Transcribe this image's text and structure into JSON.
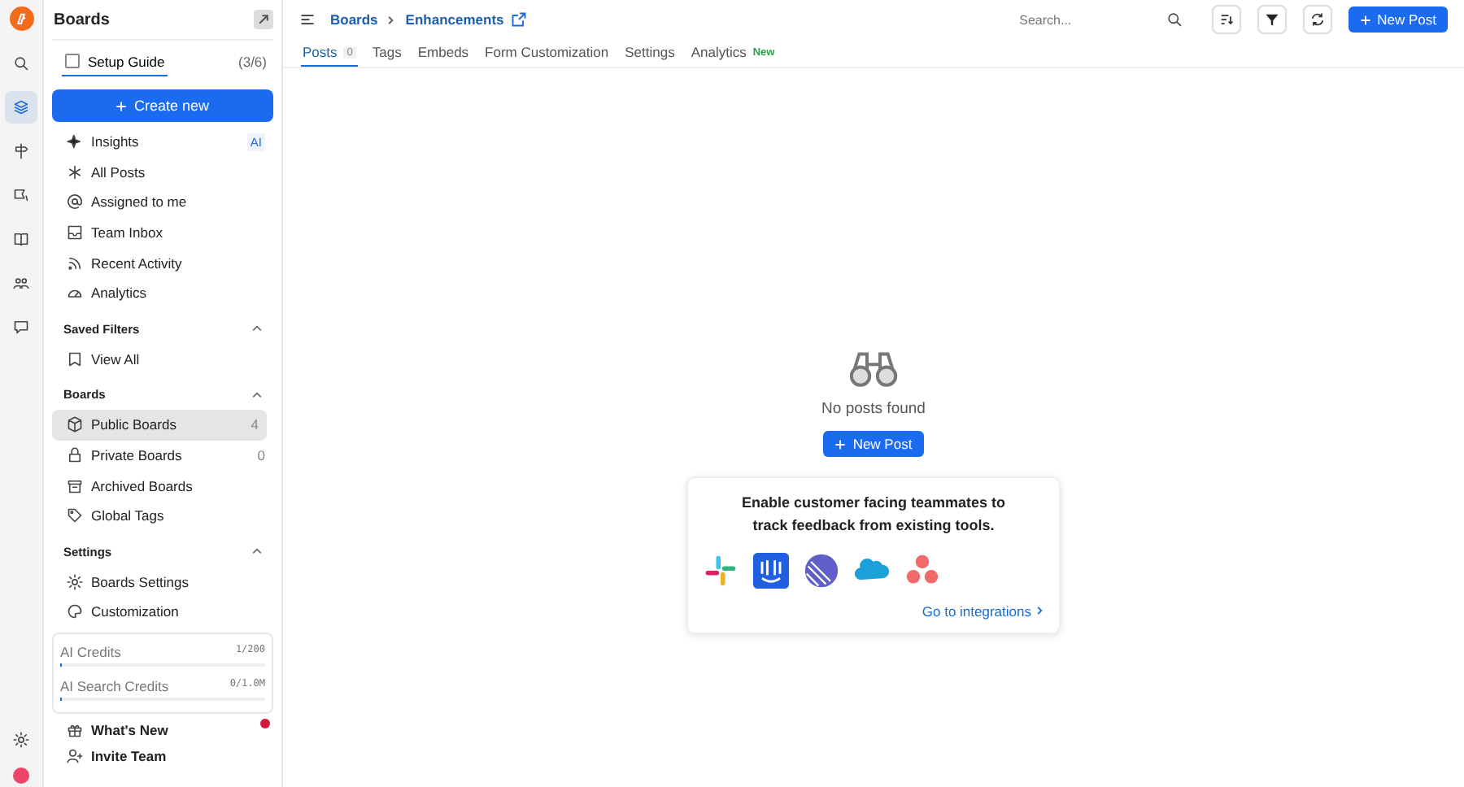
{
  "rail": [
    {
      "kind": "search",
      "selected": false
    },
    {
      "kind": "layers",
      "selected": true
    },
    {
      "kind": "signpost",
      "selected": false
    },
    {
      "kind": "flag",
      "selected": false
    },
    {
      "kind": "book",
      "selected": false
    },
    {
      "kind": "people",
      "selected": false
    },
    {
      "kind": "chat",
      "selected": false
    }
  ],
  "sidebar": {
    "title": "Boards",
    "setup_guide": {
      "label": "Setup Guide",
      "progress": "(3/6)",
      "checked": false
    },
    "create_button": "Create new",
    "nav": [
      {
        "kind": "sparkle",
        "label": "Insights",
        "badge": "AI"
      },
      {
        "kind": "star",
        "label": "All Posts"
      },
      {
        "kind": "at",
        "label": "Assigned to me"
      },
      {
        "kind": "inbox",
        "label": "Team Inbox"
      },
      {
        "kind": "rss",
        "label": "Recent Activity"
      },
      {
        "kind": "gauge",
        "label": "Analytics"
      }
    ],
    "sections": [
      {
        "title": "Saved Filters",
        "expanded": true,
        "items": [
          {
            "kind": "bookmark",
            "label": "View All",
            "selected": false
          }
        ]
      },
      {
        "title": "Boards",
        "expanded": true,
        "items": [
          {
            "kind": "cube",
            "label": "Public Boards",
            "count": "4",
            "selected": true
          },
          {
            "kind": "lock",
            "label": "Private Boards",
            "count": "0",
            "selected": false
          },
          {
            "kind": "archive",
            "label": "Archived Boards",
            "selected": false
          },
          {
            "kind": "tag",
            "label": "Global Tags",
            "selected": false
          }
        ]
      },
      {
        "title": "Settings",
        "expanded": true,
        "items": [
          {
            "kind": "gear",
            "label": "Boards Settings",
            "selected": false
          },
          {
            "kind": "palette",
            "label": "Customization",
            "selected": false
          }
        ]
      }
    ],
    "credits": [
      {
        "label": "AI Credits",
        "reading": "1/200",
        "level": 0.005
      },
      {
        "label": "AI Search Credits",
        "reading": "0/1.0M",
        "level": 0
      }
    ],
    "footer": [
      {
        "kind": "gift",
        "label": "What's New",
        "notification": true
      },
      {
        "kind": "person-add",
        "label": "Invite Team",
        "notification": false
      }
    ]
  },
  "header": {
    "breadcrumb": [
      "Boards",
      "Enhancements"
    ],
    "search": {
      "placeholder": "Search..."
    },
    "new_post": "New Post",
    "tabs": [
      {
        "label": "Posts",
        "count": "0",
        "selected": true
      },
      {
        "label": "Tags",
        "selected": false
      },
      {
        "label": "Embeds",
        "selected": false
      },
      {
        "label": "Form Customization",
        "selected": false
      },
      {
        "label": "Settings",
        "selected": false
      },
      {
        "label": "Analytics",
        "badge": "New",
        "selected": false
      }
    ]
  },
  "empty": {
    "message": "No posts found",
    "button": "New Post"
  },
  "integrations": {
    "text": "Enable customer facing teammates to track feedback from existing tools.",
    "link": "Go to integrations",
    "logos": [
      {
        "kind": "slack"
      },
      {
        "kind": "intercom"
      },
      {
        "kind": "linear"
      },
      {
        "kind": "salesforce"
      },
      {
        "kind": "asana"
      }
    ]
  }
}
